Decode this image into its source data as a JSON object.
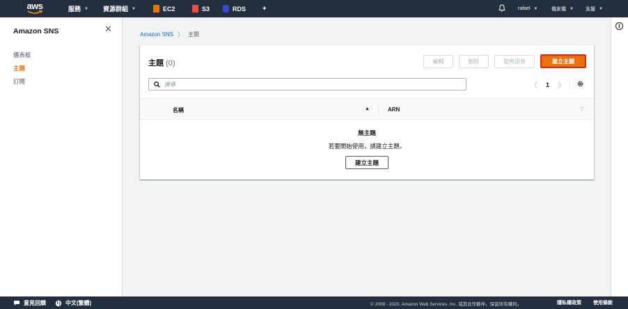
{
  "topnav": {
    "logo": "aws",
    "services": "服務",
    "resource_groups": "資源群組",
    "ec2": "EC2",
    "s3": "S3",
    "rds": "RDS",
    "user": "rafael",
    "region": "俄亥俄",
    "support": "支援"
  },
  "sidebar": {
    "title": "Amazon SNS",
    "items": [
      {
        "label": "儀表板"
      },
      {
        "label": "主題"
      },
      {
        "label": "訂閱"
      }
    ]
  },
  "breadcrumb": {
    "root": "Amazon SNS",
    "current": "主題"
  },
  "panel": {
    "title": "主題",
    "count": "(0)",
    "buttons": {
      "edit": "編輯",
      "delete": "刪除",
      "publish": "發佈訊息",
      "create": "建立主題"
    },
    "search_placeholder": "搜尋",
    "page": "1",
    "columns": [
      "名稱",
      "ARN"
    ],
    "empty_title": "無主題",
    "empty_desc": "若要開始使用，請建立主題。",
    "empty_button": "建立主題"
  },
  "footer": {
    "feedback": "意見回饋",
    "language": "中文(繁體)",
    "copyright": "© 2008 - 2020, Amazon Web Services, Inc. 或其合作夥伴。保留所有權利。",
    "privacy": "隱私權政策",
    "terms": "使用條款"
  },
  "colors": {
    "nav_bg": "#232f3e",
    "accent": "#ec7211",
    "link": "#0073bb"
  }
}
